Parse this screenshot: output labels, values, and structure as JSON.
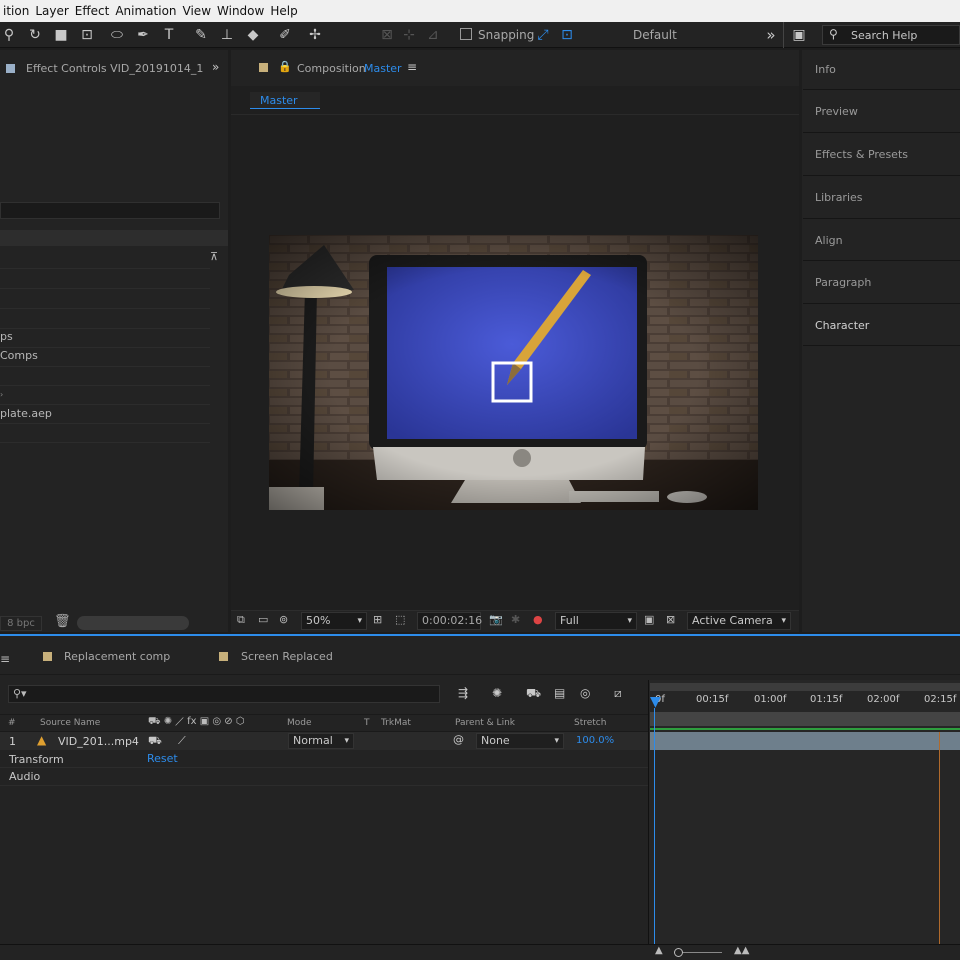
{
  "menubar": [
    "ition",
    "Layer",
    "Effect",
    "Animation",
    "View",
    "Window",
    "Help"
  ],
  "toolbar": {
    "snapping": "Snapping",
    "workspace": "Default",
    "search_help": "Search Help"
  },
  "effect_controls": {
    "title": "Effect Controls VID_20191014_1"
  },
  "composition": {
    "title_prefix": "Composition",
    "title_name": "Master",
    "tab": "Master",
    "zoom": "50%",
    "timecode": "0:00:02:16",
    "resolution": "Full",
    "camera": "Active Camera"
  },
  "project": {
    "items": [
      "ps",
      "Comps",
      "",
      "plate.aep"
    ],
    "bpc": "8 bpc"
  },
  "right_panels": [
    "Info",
    "Preview",
    "Effects & Presets",
    "Libraries",
    "Align",
    "Paragraph",
    "Character"
  ],
  "timeline": {
    "tabs": [
      "Replacement comp",
      "Screen Replaced"
    ],
    "search_placeholder": "",
    "columns": {
      "num": "#",
      "source": "Source Name",
      "mode": "Mode",
      "t": "T",
      "trkmat": "TrkMat",
      "parent": "Parent & Link",
      "stretch": "Stretch"
    },
    "layer": {
      "num": "1",
      "name": "VID_201...mp4",
      "mode": "Normal",
      "parent": "None",
      "stretch": "100.0%"
    },
    "props": {
      "transform": "Transform",
      "reset": "Reset",
      "audio": "Audio"
    },
    "ruler": [
      "0f",
      "00:15f",
      "01:00f",
      "01:15f",
      "02:00f",
      "02:15f"
    ]
  },
  "colors": {
    "accent_blue": "#2d8ceb",
    "tab_swatch": "#c7b07b",
    "track_green": "#2e9e3e"
  }
}
